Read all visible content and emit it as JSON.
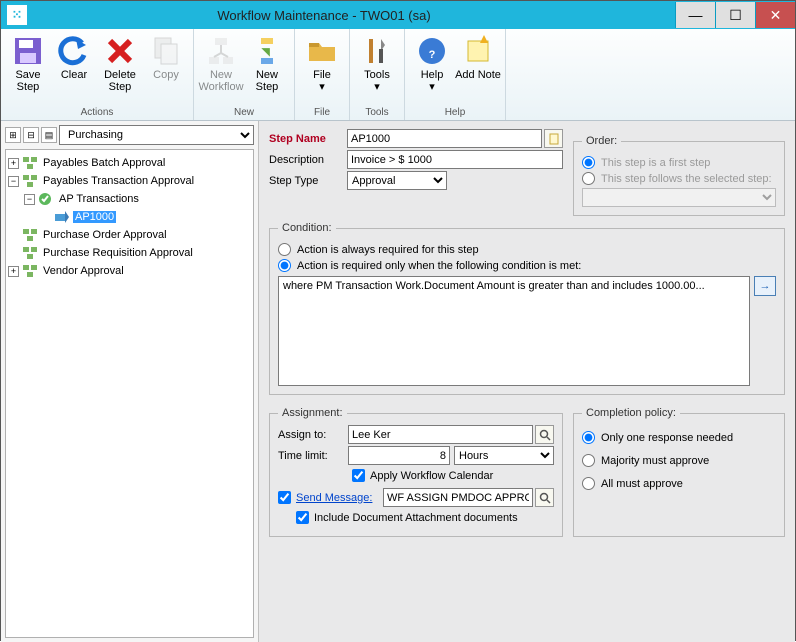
{
  "window": {
    "title": "Workflow Maintenance  -  TWO01 (sa)"
  },
  "ribbon": {
    "save": "Save Step",
    "clear": "Clear",
    "delete": "Delete Step",
    "copy": "Copy",
    "newwf": "New Workflow",
    "newstep": "New Step",
    "file": "File",
    "tools": "Tools",
    "help": "Help",
    "addnote": "Add Note",
    "g_actions": "Actions",
    "g_new": "New",
    "g_file": "File",
    "g_tools": "Tools",
    "g_help": "Help"
  },
  "left": {
    "series": "Purchasing",
    "tree": {
      "n1": "Payables Batch Approval",
      "n2": "Payables Transaction Approval",
      "n3": "AP Transactions",
      "n4": "AP1000",
      "n5": "Purchase Order Approval",
      "n6": "Purchase Requisition Approval",
      "n7": "Vendor Approval"
    }
  },
  "fields": {
    "stepname_lbl": "Step Name",
    "stepname": "AP1000",
    "desc_lbl": "Description",
    "desc": "Invoice > $ 1000",
    "type_lbl": "Step Type",
    "type": "Approval"
  },
  "order": {
    "legend": "Order:",
    "r1": "This step is a first step",
    "r2": "This step follows the selected step:"
  },
  "condition": {
    "legend": "Condition:",
    "r1": "Action is always required for this step",
    "r2": "Action is required only when the following condition is met:",
    "text": "where PM Transaction Work.Document Amount is greater than and includes 1000.00..."
  },
  "assignment": {
    "legend": "Assignment:",
    "assignto_lbl": "Assign to:",
    "assignto": "Lee Ker",
    "timelimit_lbl": "Time limit:",
    "timelimit_val": "8",
    "timelimit_unit": "Hours",
    "applycal": "Apply Workflow Calendar",
    "sendmsg_lbl": "Send Message:",
    "sendmsg_val": "WF ASSIGN PMDOC APPROVAL",
    "includedoc": "Include Document Attachment documents"
  },
  "completion": {
    "legend": "Completion policy:",
    "r1": "Only one response needed",
    "r2": "Majority must approve",
    "r3": "All must approve"
  }
}
